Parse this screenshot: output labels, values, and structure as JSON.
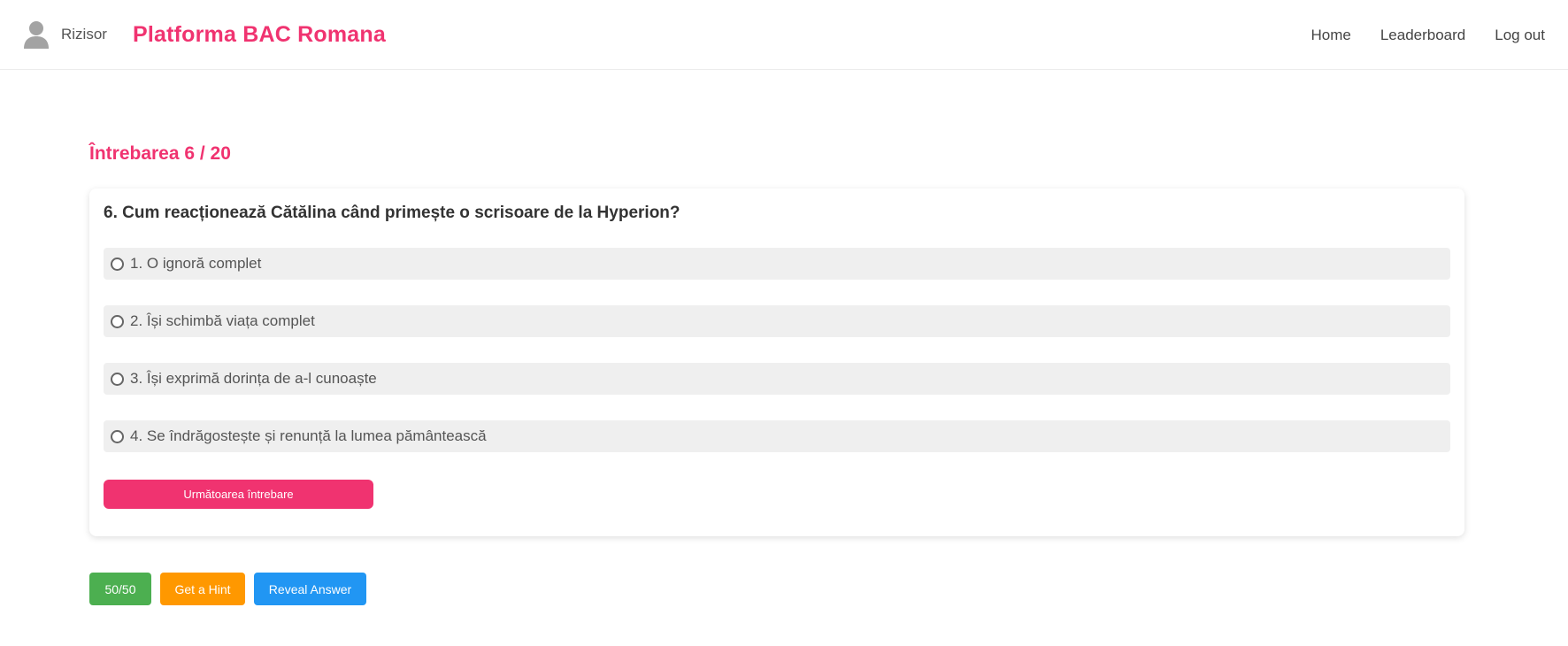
{
  "nav": {
    "username": "Rizisor",
    "brand": "Platforma BAC Romana",
    "links": [
      "Home",
      "Leaderboard",
      "Log out"
    ]
  },
  "quiz": {
    "progress": "Întrebarea 6 / 20",
    "current": 6,
    "total": 20,
    "question": "6. Cum reacționează Cătălina când primește o scrisoare de la Hyperion?",
    "options": [
      "1. O ignoră complet",
      "2. Își schimbă viața complet",
      "3. Își exprimă dorința de a-l cunoaște",
      "4. Se îndrăgostește și renunță la lumea pământească"
    ],
    "next_label": "Următoarea întrebare"
  },
  "lifelines": {
    "fifty": "50/50",
    "hint": "Get a Hint",
    "reveal": "Reveal Answer"
  },
  "colors": {
    "brand": "#f03370",
    "fifty": "#4caf50",
    "hint": "#ff9800",
    "reveal": "#2196f3",
    "option_bg": "#efefef"
  },
  "icons": {
    "avatar": "user-avatar-icon",
    "radio": "radio-empty-icon"
  }
}
